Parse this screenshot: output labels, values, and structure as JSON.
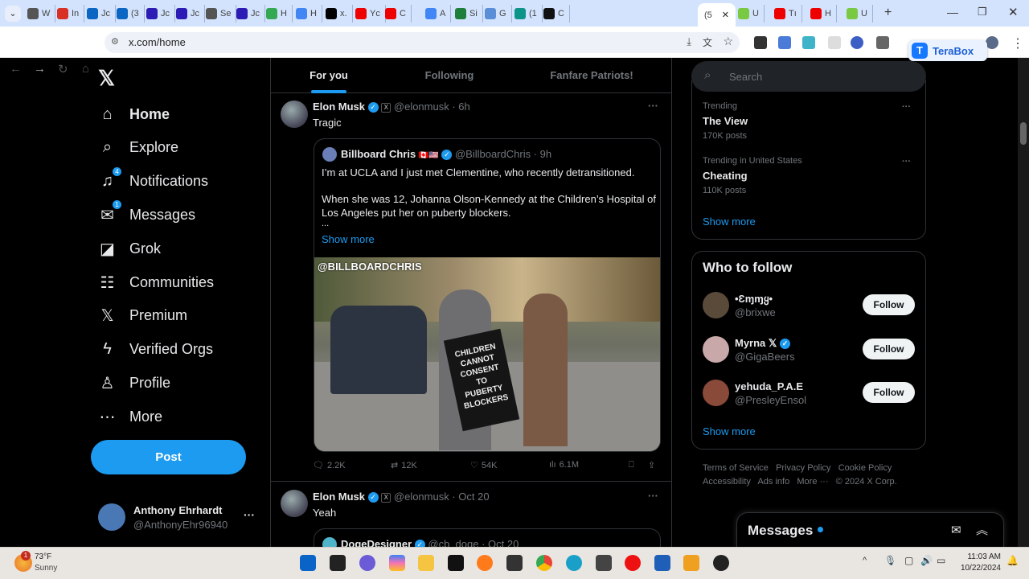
{
  "browser": {
    "tabs": [
      {
        "label": "W",
        "color": "#555"
      },
      {
        "label": "In",
        "color": "#d93025"
      },
      {
        "label": "Jc",
        "color": "#0a66c2"
      },
      {
        "label": "(3",
        "color": "#0a66c2"
      },
      {
        "label": "Jc",
        "color": "#2d1bb5"
      },
      {
        "label": "Jc",
        "color": "#2d1bb5"
      },
      {
        "label": "Se",
        "color": "#555"
      },
      {
        "label": "Jc",
        "color": "#2d1bb5"
      },
      {
        "label": "H",
        "color": "#34a853"
      },
      {
        "label": "H",
        "color": "#4285f4"
      },
      {
        "label": "x.",
        "color": "#000"
      },
      {
        "label": "Yc",
        "color": "#e00"
      },
      {
        "label": "C",
        "color": "#e00"
      },
      {
        "label": "A",
        "color": "#4285f4"
      },
      {
        "label": "Si",
        "color": "#1e7f3a"
      },
      {
        "label": "G",
        "color": "#5a8fd8"
      },
      {
        "label": "(1",
        "color": "#0d9488"
      },
      {
        "label": "C",
        "color": "#111"
      }
    ],
    "active_tab": "(5",
    "tabs_after": [
      {
        "label": "U",
        "color": "#7ac943"
      },
      {
        "label": "Tı",
        "color": "#e00"
      },
      {
        "label": "H",
        "color": "#e00"
      },
      {
        "label": "U",
        "color": "#7ac943"
      }
    ],
    "url": "x.com/home",
    "terabox": "TeraBox"
  },
  "nav": {
    "items": [
      {
        "label": "Home",
        "icon": "⌂"
      },
      {
        "label": "Explore",
        "icon": "⌕"
      },
      {
        "label": "Notifications",
        "icon": "♫",
        "badge": "4"
      },
      {
        "label": "Messages",
        "icon": "✉",
        "badge": "1"
      },
      {
        "label": "Grok",
        "icon": "◪"
      },
      {
        "label": "Communities",
        "icon": "☷"
      },
      {
        "label": "Premium",
        "icon": "𝕏"
      },
      {
        "label": "Verified Orgs",
        "icon": "ϟ"
      },
      {
        "label": "Profile",
        "icon": "♙"
      },
      {
        "label": "More",
        "icon": "⋯"
      }
    ],
    "post": "Post",
    "account": {
      "name": "Anthony Ehrhardt",
      "handle": "@AnthonyEhr96940"
    }
  },
  "feed": {
    "tabs": [
      "For you",
      "Following",
      "Fanfare Patriots!"
    ],
    "tweet1": {
      "name": "Elon Musk",
      "handle": "@elonmusk",
      "time": "· 6h",
      "text": "Tragic",
      "quote": {
        "name": "Billboard Chris",
        "flags": "🇨🇦🇺🇸",
        "handle": "@BillboardChris",
        "time": "· 9h",
        "line1": "I’m at UCLA and I just met Clementine, who recently detransitioned.",
        "line2": "When she was 12, Johanna Olson-Kennedy at the Children’s Hospital of",
        "line3": "Los Angeles put her on puberty blockers.",
        "ellipsis": "...",
        "show_more": "Show more",
        "watermark": "@BILLBOARDCHRIS",
        "sign": "CHILDREN CANNOT CONSENT TO PUBERTY BLOCKERS"
      },
      "replies": "2.2K",
      "reposts": "12K",
      "likes": "54K",
      "views": "6.1M"
    },
    "tweet2": {
      "name": "Elon Musk",
      "handle": "@elonmusk",
      "time": "· Oct 20",
      "text": "Yeah",
      "quote": {
        "name": "DogeDesigner",
        "handle": "@cb_doge",
        "time": "· Oct 20"
      }
    }
  },
  "right": {
    "search_placeholder": "Search",
    "trends": [
      {
        "context": "Trending",
        "title": "The View",
        "posts": "170K posts"
      },
      {
        "context": "Trending in United States",
        "title": "Cheating",
        "posts": "110K posts"
      }
    ],
    "show_more": "Show more",
    "wtf_title": "Who to follow",
    "follow": [
      {
        "name": "•Ɛɱɱყ•",
        "handle": "@brixwe",
        "verified": false
      },
      {
        "name": "Myrna 𝕏",
        "handle": "@GigaBeers",
        "verified": true
      },
      {
        "name": "yehuda_P.A.E",
        "handle": "@PresleyEnsol",
        "verified": false
      }
    ],
    "follow_label": "Follow",
    "footer": [
      "Terms of Service",
      "Privacy Policy",
      "Cookie Policy",
      "Accessibility",
      "Ads info",
      "More ···",
      "© 2024 X Corp."
    ],
    "messages": "Messages"
  },
  "taskbar": {
    "weather_temp": "73°F",
    "weather_desc": "Sunny",
    "weather_badge": "1",
    "time": "11:03 AM",
    "date": "10/22/2024"
  }
}
